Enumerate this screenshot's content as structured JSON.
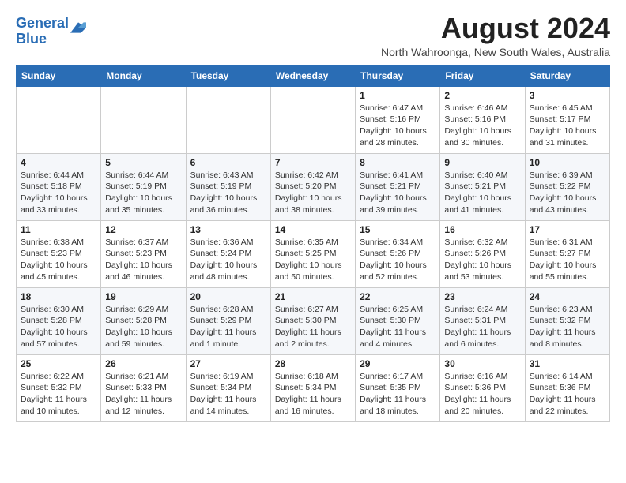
{
  "logo": {
    "line1": "General",
    "line2": "Blue"
  },
  "title": "August 2024",
  "location": "North Wahroonga, New South Wales, Australia",
  "days_of_week": [
    "Sunday",
    "Monday",
    "Tuesday",
    "Wednesday",
    "Thursday",
    "Friday",
    "Saturday"
  ],
  "weeks": [
    [
      {
        "day": "",
        "info": ""
      },
      {
        "day": "",
        "info": ""
      },
      {
        "day": "",
        "info": ""
      },
      {
        "day": "",
        "info": ""
      },
      {
        "day": "1",
        "info": "Sunrise: 6:47 AM\nSunset: 5:16 PM\nDaylight: 10 hours\nand 28 minutes."
      },
      {
        "day": "2",
        "info": "Sunrise: 6:46 AM\nSunset: 5:16 PM\nDaylight: 10 hours\nand 30 minutes."
      },
      {
        "day": "3",
        "info": "Sunrise: 6:45 AM\nSunset: 5:17 PM\nDaylight: 10 hours\nand 31 minutes."
      }
    ],
    [
      {
        "day": "4",
        "info": "Sunrise: 6:44 AM\nSunset: 5:18 PM\nDaylight: 10 hours\nand 33 minutes."
      },
      {
        "day": "5",
        "info": "Sunrise: 6:44 AM\nSunset: 5:19 PM\nDaylight: 10 hours\nand 35 minutes."
      },
      {
        "day": "6",
        "info": "Sunrise: 6:43 AM\nSunset: 5:19 PM\nDaylight: 10 hours\nand 36 minutes."
      },
      {
        "day": "7",
        "info": "Sunrise: 6:42 AM\nSunset: 5:20 PM\nDaylight: 10 hours\nand 38 minutes."
      },
      {
        "day": "8",
        "info": "Sunrise: 6:41 AM\nSunset: 5:21 PM\nDaylight: 10 hours\nand 39 minutes."
      },
      {
        "day": "9",
        "info": "Sunrise: 6:40 AM\nSunset: 5:21 PM\nDaylight: 10 hours\nand 41 minutes."
      },
      {
        "day": "10",
        "info": "Sunrise: 6:39 AM\nSunset: 5:22 PM\nDaylight: 10 hours\nand 43 minutes."
      }
    ],
    [
      {
        "day": "11",
        "info": "Sunrise: 6:38 AM\nSunset: 5:23 PM\nDaylight: 10 hours\nand 45 minutes."
      },
      {
        "day": "12",
        "info": "Sunrise: 6:37 AM\nSunset: 5:23 PM\nDaylight: 10 hours\nand 46 minutes."
      },
      {
        "day": "13",
        "info": "Sunrise: 6:36 AM\nSunset: 5:24 PM\nDaylight: 10 hours\nand 48 minutes."
      },
      {
        "day": "14",
        "info": "Sunrise: 6:35 AM\nSunset: 5:25 PM\nDaylight: 10 hours\nand 50 minutes."
      },
      {
        "day": "15",
        "info": "Sunrise: 6:34 AM\nSunset: 5:26 PM\nDaylight: 10 hours\nand 52 minutes."
      },
      {
        "day": "16",
        "info": "Sunrise: 6:32 AM\nSunset: 5:26 PM\nDaylight: 10 hours\nand 53 minutes."
      },
      {
        "day": "17",
        "info": "Sunrise: 6:31 AM\nSunset: 5:27 PM\nDaylight: 10 hours\nand 55 minutes."
      }
    ],
    [
      {
        "day": "18",
        "info": "Sunrise: 6:30 AM\nSunset: 5:28 PM\nDaylight: 10 hours\nand 57 minutes."
      },
      {
        "day": "19",
        "info": "Sunrise: 6:29 AM\nSunset: 5:28 PM\nDaylight: 10 hours\nand 59 minutes."
      },
      {
        "day": "20",
        "info": "Sunrise: 6:28 AM\nSunset: 5:29 PM\nDaylight: 11 hours\nand 1 minute."
      },
      {
        "day": "21",
        "info": "Sunrise: 6:27 AM\nSunset: 5:30 PM\nDaylight: 11 hours\nand 2 minutes."
      },
      {
        "day": "22",
        "info": "Sunrise: 6:25 AM\nSunset: 5:30 PM\nDaylight: 11 hours\nand 4 minutes."
      },
      {
        "day": "23",
        "info": "Sunrise: 6:24 AM\nSunset: 5:31 PM\nDaylight: 11 hours\nand 6 minutes."
      },
      {
        "day": "24",
        "info": "Sunrise: 6:23 AM\nSunset: 5:32 PM\nDaylight: 11 hours\nand 8 minutes."
      }
    ],
    [
      {
        "day": "25",
        "info": "Sunrise: 6:22 AM\nSunset: 5:32 PM\nDaylight: 11 hours\nand 10 minutes."
      },
      {
        "day": "26",
        "info": "Sunrise: 6:21 AM\nSunset: 5:33 PM\nDaylight: 11 hours\nand 12 minutes."
      },
      {
        "day": "27",
        "info": "Sunrise: 6:19 AM\nSunset: 5:34 PM\nDaylight: 11 hours\nand 14 minutes."
      },
      {
        "day": "28",
        "info": "Sunrise: 6:18 AM\nSunset: 5:34 PM\nDaylight: 11 hours\nand 16 minutes."
      },
      {
        "day": "29",
        "info": "Sunrise: 6:17 AM\nSunset: 5:35 PM\nDaylight: 11 hours\nand 18 minutes."
      },
      {
        "day": "30",
        "info": "Sunrise: 6:16 AM\nSunset: 5:36 PM\nDaylight: 11 hours\nand 20 minutes."
      },
      {
        "day": "31",
        "info": "Sunrise: 6:14 AM\nSunset: 5:36 PM\nDaylight: 11 hours\nand 22 minutes."
      }
    ]
  ]
}
